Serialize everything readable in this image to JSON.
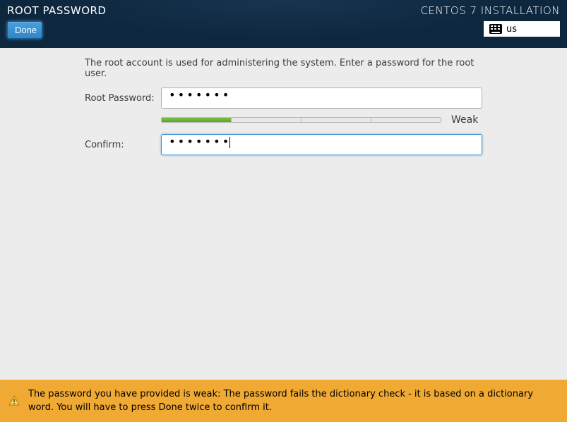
{
  "header": {
    "title": "ROOT PASSWORD",
    "done_label": "Done",
    "install_title": "CENTOS 7 INSTALLATION",
    "keyboard_layout": "us"
  },
  "form": {
    "instruction": "The root account is used for administering the system.   Enter a password for the root user.",
    "root_label": "Root Password:",
    "root_value": "•••••••",
    "confirm_label": "Confirm:",
    "confirm_value": "•••••••",
    "strength_label": "Weak",
    "strength_segments_filled": 1,
    "strength_segments_total": 4
  },
  "warning": {
    "text": "The password you have provided is weak: The password fails the dictionary check - it is based on a dictionary word. You will have to press Done twice to confirm it."
  }
}
